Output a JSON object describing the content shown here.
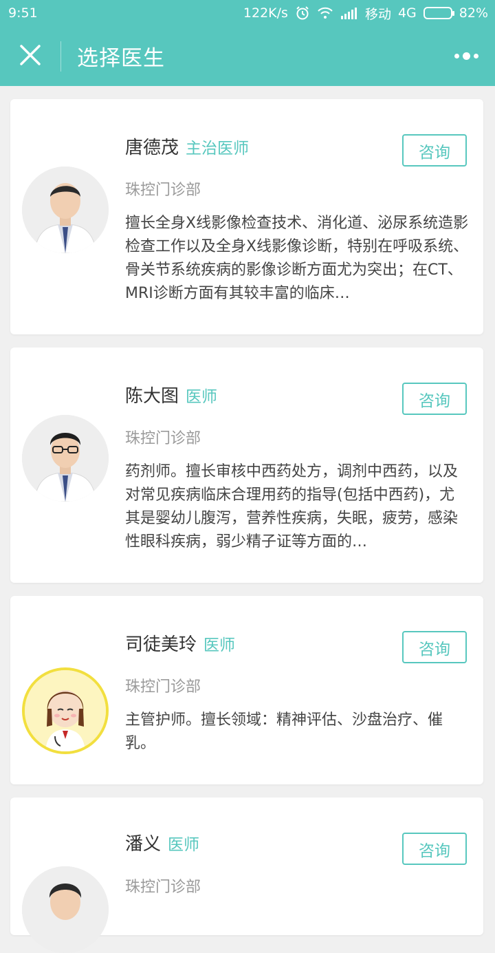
{
  "status_bar": {
    "time": "9:51",
    "speed": "122K/s",
    "carrier": "移动",
    "network": "4G",
    "battery_percent": "82%",
    "battery_level": 0.82,
    "icons": [
      "alarm-icon",
      "wifi-icon",
      "signal-icon",
      "battery-icon"
    ]
  },
  "app_bar": {
    "title": "选择医生",
    "close_icon": "close-icon",
    "more_icon": "more-icon"
  },
  "theme": {
    "accent": "#57c7be",
    "text": "#333333",
    "muted": "#9a9a9a",
    "background": "#f0f0f0"
  },
  "doctors": [
    {
      "name": "唐德茂",
      "title": "主治医师",
      "department": "珠控门诊部",
      "description": "擅长全身X线影像检查技术、消化道、泌尿系统造影检查工作以及全身X线影像诊断，特别在呼吸系统、骨关节系统疾病的影像诊断方面尤为突出；在CT、MRI诊断方面有其较丰富的临床…",
      "button": "咨询"
    },
    {
      "name": "陈大图",
      "title": "医师",
      "department": "珠控门诊部",
      "description": "药剂师。擅长审核中西药处方，调剂中西药，以及对常见疾病临床合理用药的指导(包括中西药)，尤其是婴幼儿腹泻，营养性疾病，失眠，疲劳，感染性眼科疾病，弱少精子证等方面的…",
      "button": "咨询"
    },
    {
      "name": "司徒美玲",
      "title": "医师",
      "department": "珠控门诊部",
      "description": "主管护师。擅长领域：精神评估、沙盘治疗、催乳。",
      "button": "咨询"
    },
    {
      "name": "潘义",
      "title": "医师",
      "department": "珠控门诊部",
      "description": "",
      "button": "咨询"
    }
  ]
}
